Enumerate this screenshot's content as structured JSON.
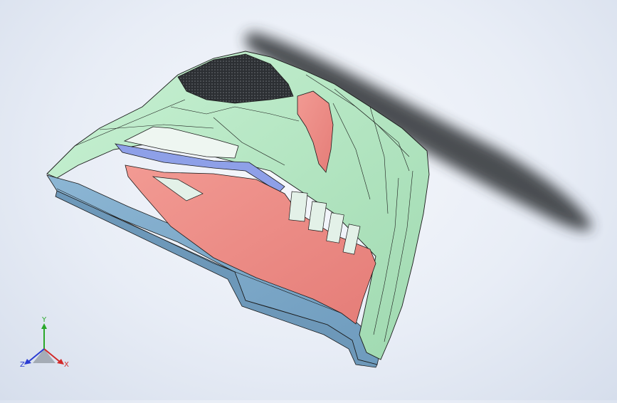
{
  "view": {
    "background_top": "#f6f8fc",
    "background_bottom": "#d6deec"
  },
  "model": {
    "colors": {
      "top_face": "#b9ebc8",
      "underside": "#7ea9c9",
      "cavity": "#ef8f89",
      "insert": "#8ea0e8",
      "mesh": "#2c2f33",
      "edge": "#1a1a1a",
      "shadow": "#2e3135"
    }
  },
  "triad": {
    "x_label": "X",
    "y_label": "Y",
    "z_label": "Z",
    "x_color": "#d22a2a",
    "y_color": "#2aa82a",
    "z_color": "#2a3cd2"
  }
}
